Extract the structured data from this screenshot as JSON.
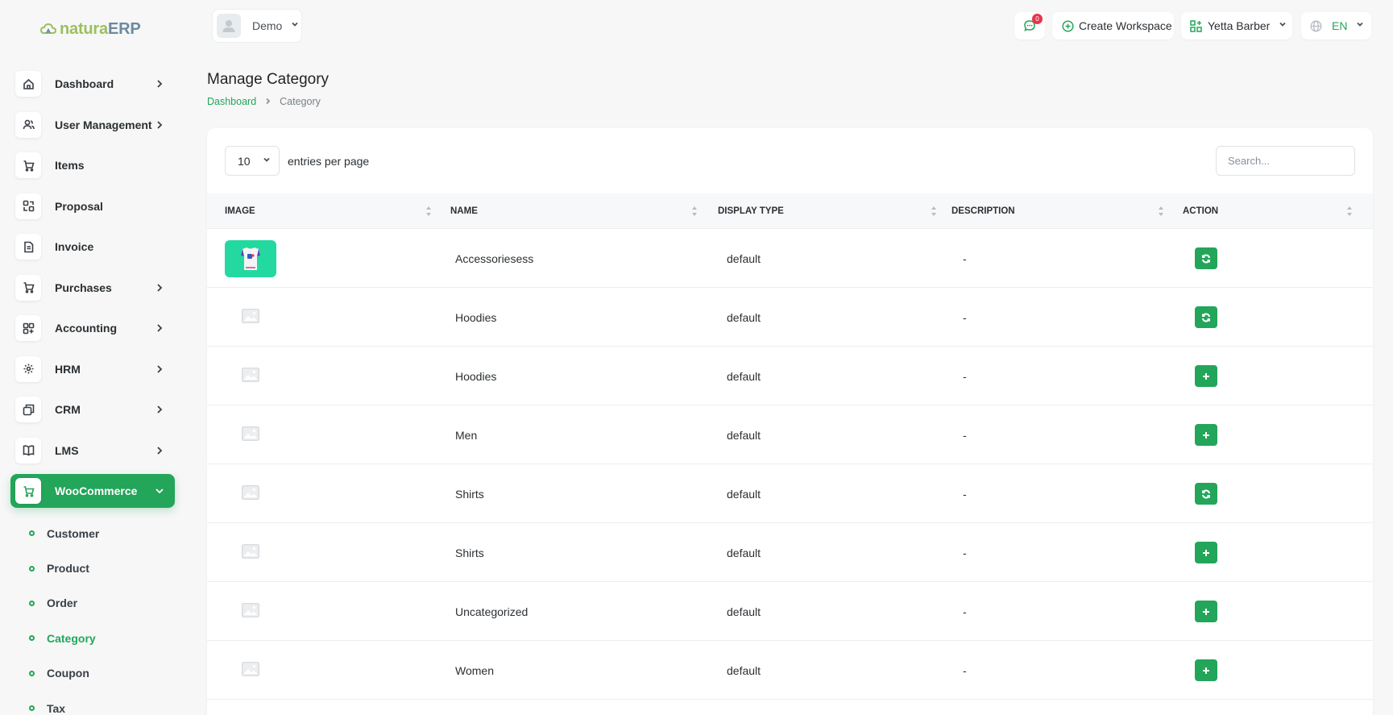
{
  "app": {
    "logo": {
      "part1": "natura",
      "part2": "ERP"
    }
  },
  "sidebar": {
    "items": [
      {
        "label": "Dashboard",
        "icon": "home-icon",
        "has_children": true,
        "active": false
      },
      {
        "label": "User Management",
        "icon": "users-icon",
        "has_children": true,
        "active": false
      },
      {
        "label": "Items",
        "icon": "cart-icon",
        "has_children": false,
        "active": false
      },
      {
        "label": "Proposal",
        "icon": "proposal-icon",
        "has_children": false,
        "active": false
      },
      {
        "label": "Invoice",
        "icon": "invoice-icon",
        "has_children": false,
        "active": false
      },
      {
        "label": "Purchases",
        "icon": "cart-icon",
        "has_children": true,
        "active": false
      },
      {
        "label": "Accounting",
        "icon": "grid-icon",
        "has_children": true,
        "active": false
      },
      {
        "label": "HRM",
        "icon": "hrm-icon",
        "has_children": true,
        "active": false
      },
      {
        "label": "CRM",
        "icon": "crm-icon",
        "has_children": true,
        "active": false
      },
      {
        "label": "LMS",
        "icon": "book-icon",
        "has_children": true,
        "active": false
      },
      {
        "label": "WooCommerce",
        "icon": "cart-icon",
        "has_children": true,
        "active": true
      }
    ],
    "sub_items": [
      {
        "label": "Customer",
        "active": false
      },
      {
        "label": "Product",
        "active": false
      },
      {
        "label": "Order",
        "active": false
      },
      {
        "label": "Category",
        "active": true
      },
      {
        "label": "Coupon",
        "active": false
      },
      {
        "label": "Tax",
        "active": false
      }
    ]
  },
  "topbar": {
    "workspace": "Demo",
    "notifications_count": "0",
    "create_workspace": "Create Workspace",
    "user_name": "Yetta Barber",
    "language": "EN"
  },
  "page": {
    "title": "Manage Category",
    "breadcrumb": [
      "Dashboard",
      "Category"
    ]
  },
  "table": {
    "per_page_value": "10",
    "per_page_label": "entries per page",
    "search_placeholder": "Search...",
    "columns": [
      "IMAGE",
      "NAME",
      "DISPLAY TYPE",
      "DESCRIPTION",
      "ACTION"
    ],
    "rows": [
      {
        "image": "product-thumbnail",
        "name": "Accessoriesess",
        "display_type": "default",
        "description": "-",
        "action": "sync-icon"
      },
      {
        "image": "image-placeholder-icon",
        "name": "Hoodies",
        "display_type": "default",
        "description": "-",
        "action": "sync-icon"
      },
      {
        "image": "image-placeholder-icon",
        "name": "Hoodies",
        "display_type": "default",
        "description": "-",
        "action": "plus-icon"
      },
      {
        "image": "image-placeholder-icon",
        "name": "Men",
        "display_type": "default",
        "description": "-",
        "action": "plus-icon"
      },
      {
        "image": "image-placeholder-icon",
        "name": "Shirts",
        "display_type": "default",
        "description": "-",
        "action": "sync-icon"
      },
      {
        "image": "image-placeholder-icon",
        "name": "Shirts",
        "display_type": "default",
        "description": "-",
        "action": "plus-icon"
      },
      {
        "image": "image-placeholder-icon",
        "name": "Uncategorized",
        "display_type": "default",
        "description": "-",
        "action": "plus-icon"
      },
      {
        "image": "image-placeholder-icon",
        "name": "Women",
        "display_type": "default",
        "description": "-",
        "action": "plus-icon"
      }
    ]
  },
  "colors": {
    "accent": "#23a55a",
    "badge": "#e8344e",
    "thumbnail_bg": "#23d9a0",
    "logo_green": "#9bbf5e",
    "logo_blue": "#6c8aa0"
  }
}
